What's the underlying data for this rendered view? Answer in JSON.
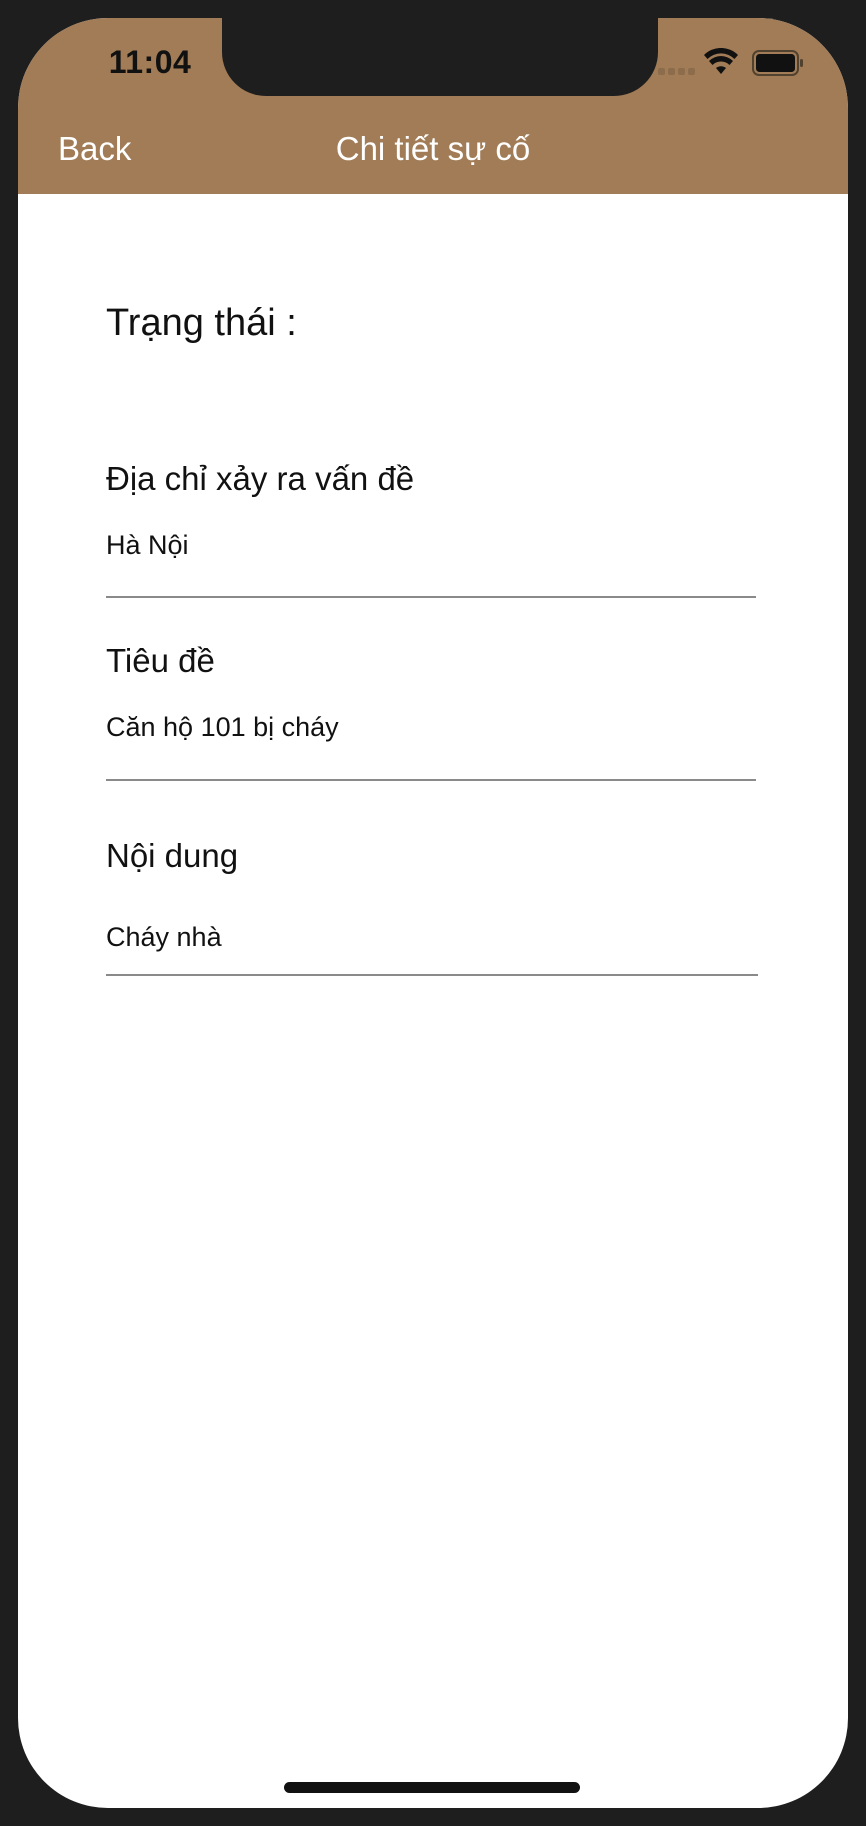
{
  "status_bar": {
    "time": "11:04",
    "icons": [
      "signal-dots-icon",
      "wifi-icon",
      "battery-icon"
    ]
  },
  "navbar": {
    "back_label": "Back",
    "title": "Chi tiết sự cố",
    "background_color": "#a17c56"
  },
  "detail": {
    "status_label": "Trạng thái :",
    "fields": [
      {
        "label": "Địa chỉ xảy ra vấn đề",
        "value": "Hà Nội"
      },
      {
        "label": "Tiêu đề",
        "value": "Căn hộ 101 bị cháy"
      },
      {
        "label": "Nội dung",
        "value": "Cháy nhà"
      }
    ]
  }
}
